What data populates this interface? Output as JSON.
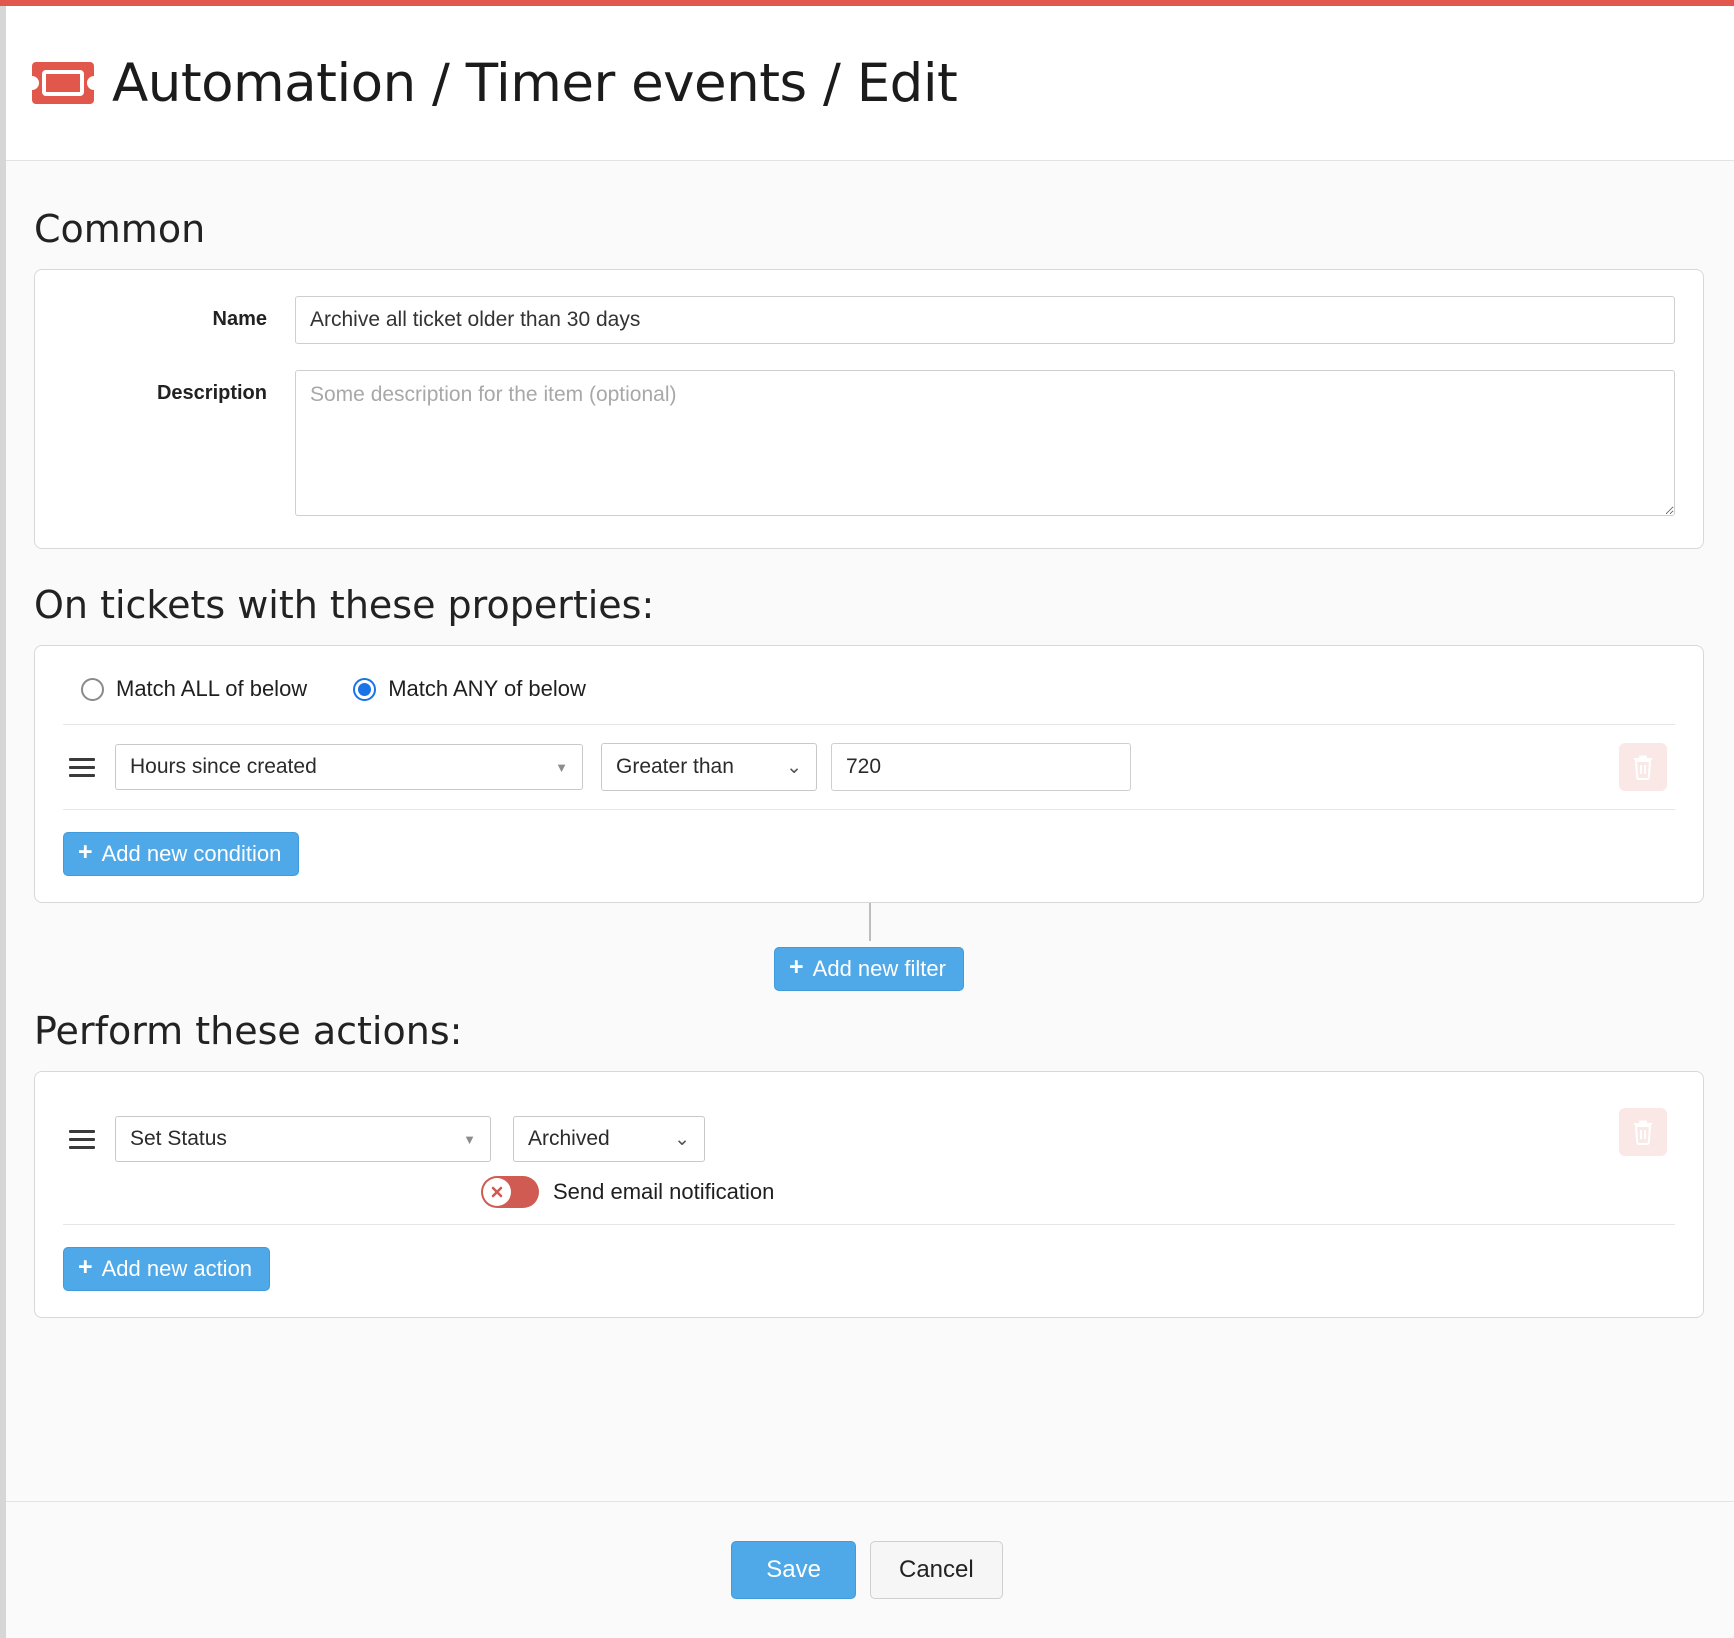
{
  "theme": {
    "accent_red": "#e2574c",
    "primary_blue": "#4fa8e8",
    "radio_blue": "#1a73e8",
    "toggle_off_red": "#cf5b52",
    "page_bg": "#fafafa"
  },
  "header": {
    "icon": "ticket-icon",
    "title": "Automation / Timer events / Edit"
  },
  "common": {
    "section_title": "Common",
    "name_label": "Name",
    "name_value": "Archive all ticket older than 30 days",
    "name_placeholder": "",
    "description_label": "Description",
    "description_value": "",
    "description_placeholder": "Some description for the item (optional)"
  },
  "conditions": {
    "section_title": "On tickets with these properties:",
    "match_options": [
      {
        "label": "Match ALL of below",
        "selected": false
      },
      {
        "label": "Match ANY of below",
        "selected": true
      }
    ],
    "rows": [
      {
        "drag_handle": "drag-handle-icon",
        "field": "Hours since created",
        "operator": "Greater than",
        "value": "720",
        "delete_icon": "trash-icon"
      }
    ],
    "add_condition_label": "Add new condition",
    "add_filter_label": "Add new filter",
    "plus_glyph": "+"
  },
  "actions": {
    "section_title": "Perform these actions:",
    "rows": [
      {
        "drag_handle": "drag-handle-icon",
        "action": "Set Status",
        "action_value": "Archived",
        "toggle_label": "Send email notification",
        "toggle_state": "off",
        "delete_icon": "trash-icon"
      }
    ],
    "add_action_label": "Add new action"
  },
  "footer": {
    "save_label": "Save",
    "cancel_label": "Cancel"
  }
}
